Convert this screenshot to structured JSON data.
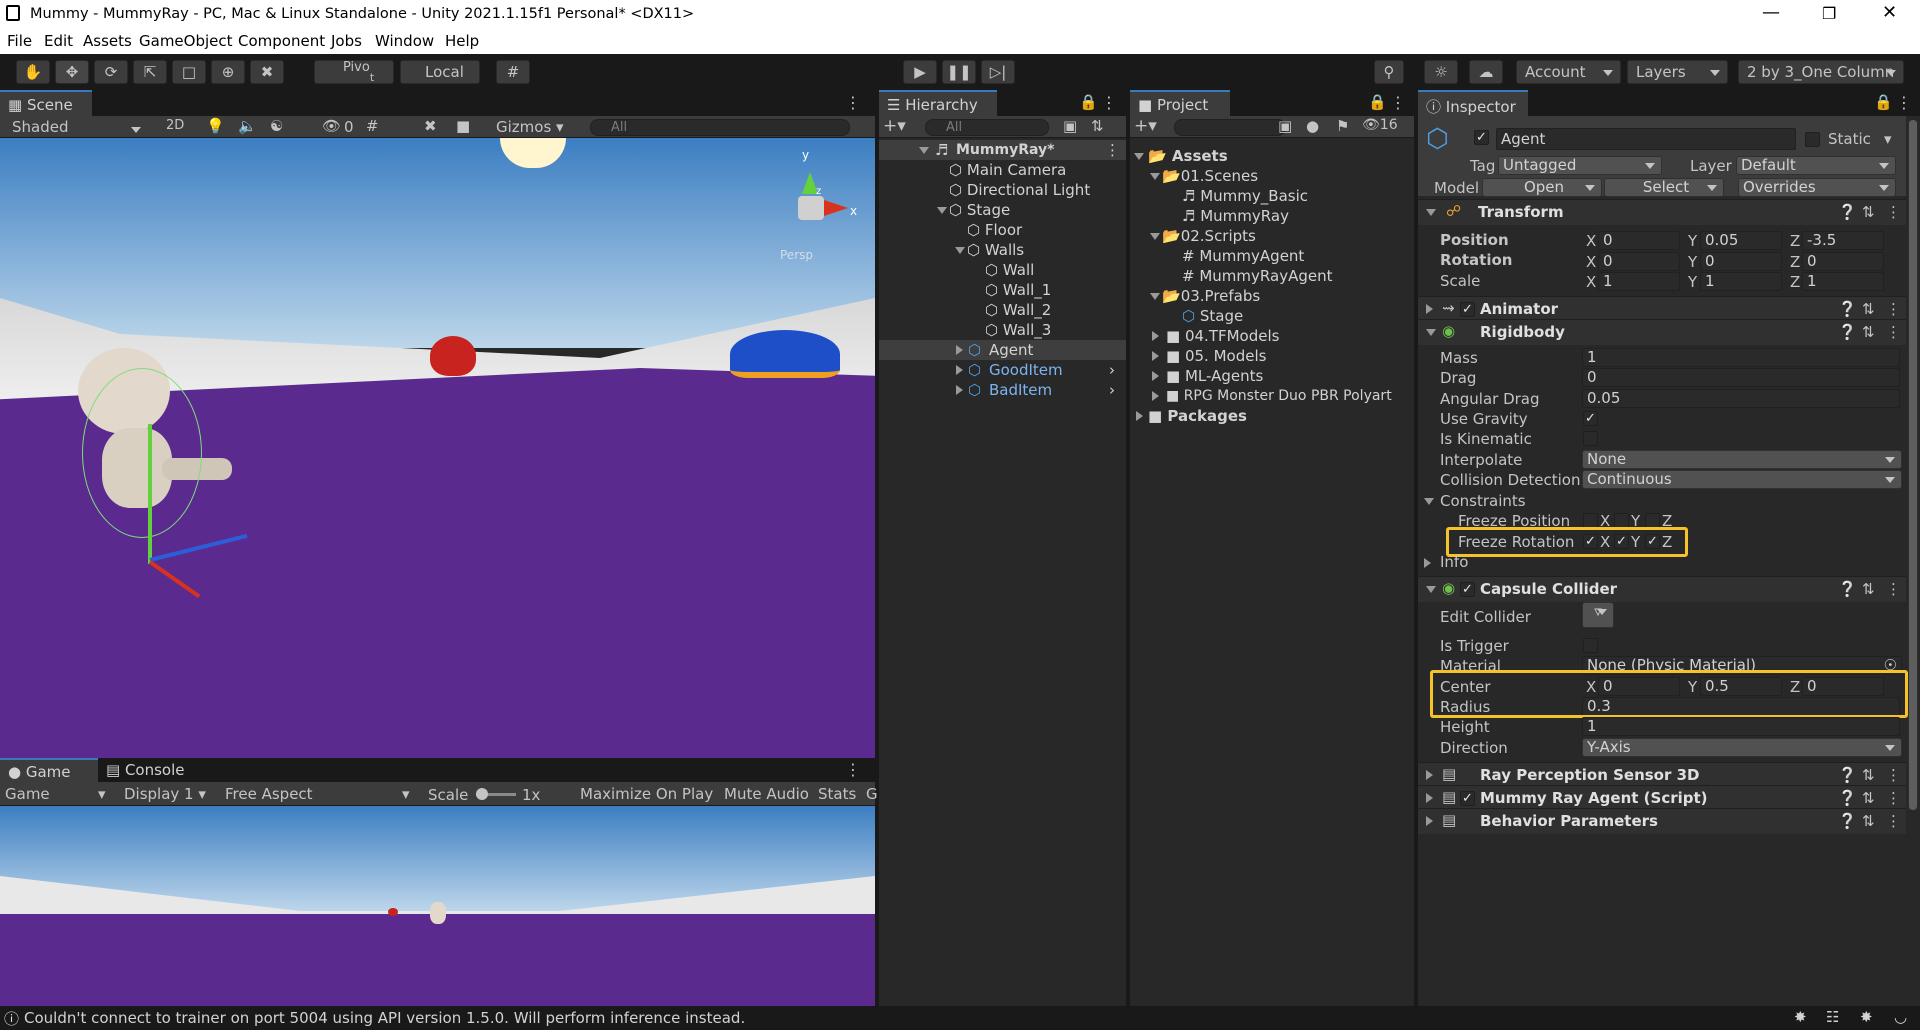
{
  "window": {
    "title": "Mummy - MummyRay - PC, Mac & Linux Standalone - Unity 2021.1.15f1 Personal* <DX11>"
  },
  "menu": [
    "File",
    "Edit",
    "Assets",
    "GameObject",
    "Component",
    "Jobs",
    "Window",
    "Help"
  ],
  "toolbar": {
    "pivot": "Pivo",
    "pivot_sub": "t",
    "local": "Local",
    "account": "Account",
    "layers": "Layers",
    "layout": "2 by 3_One Column"
  },
  "scene": {
    "tab": "Scene",
    "shading": "Shaded",
    "mode2d": "2D",
    "hidden_count": "0",
    "gizmos": "Gizmos",
    "search_placeholder": "All",
    "persp": "Persp",
    "axis_y": "y",
    "axis_x": "x",
    "axis_z": "z"
  },
  "game": {
    "tabs": [
      "Game",
      "Console"
    ],
    "display_mode": "Game",
    "display": "Display 1",
    "aspect": "Free Aspect",
    "scale_label": "Scale",
    "scale_value": "1x",
    "maximize": "Maximize On Play",
    "mute": "Mute Audio",
    "stats": "Stats",
    "gizmos_cut": "G"
  },
  "hierarchy": {
    "tab": "Hierarchy",
    "search_placeholder": "All",
    "items": [
      {
        "label": "MummyRay*",
        "bold": true
      },
      {
        "label": "Main Camera"
      },
      {
        "label": "Directional Light"
      },
      {
        "label": "Stage"
      },
      {
        "label": "Floor"
      },
      {
        "label": "Walls"
      },
      {
        "label": "Wall"
      },
      {
        "label": "Wall_1"
      },
      {
        "label": "Wall_2"
      },
      {
        "label": "Wall_3"
      },
      {
        "label": "Agent"
      },
      {
        "label": "GoodItem"
      },
      {
        "label": "BadItem"
      }
    ]
  },
  "project": {
    "tab": "Project",
    "hidden_count": "16",
    "items": [
      {
        "label": "Assets"
      },
      {
        "label": "01.Scenes"
      },
      {
        "label": "Mummy_Basic"
      },
      {
        "label": "MummyRay"
      },
      {
        "label": "02.Scripts"
      },
      {
        "label": "MummyAgent"
      },
      {
        "label": "MummyRayAgent"
      },
      {
        "label": "03.Prefabs"
      },
      {
        "label": "Stage"
      },
      {
        "label": "04.TFModels"
      },
      {
        "label": "05. Models"
      },
      {
        "label": "ML-Agents"
      },
      {
        "label": "RPG Monster Duo PBR Polyart"
      },
      {
        "label": "Packages"
      }
    ]
  },
  "inspector": {
    "tab": "Inspector",
    "object_name": "Agent",
    "static_label": "Static",
    "tag_label": "Tag",
    "tag": "Untagged",
    "layer_label": "Layer",
    "layer": "Default",
    "model_label": "Model",
    "open": "Open",
    "select": "Select",
    "overrides": "Overrides",
    "transform": {
      "name": "Transform",
      "position_label": "Position",
      "rotation_label": "Rotation",
      "scale_label": "Scale",
      "position": {
        "x": "0",
        "y": "0.05",
        "z": "-3.5"
      },
      "rotation": {
        "x": "0",
        "y": "0",
        "z": "0"
      },
      "scale": {
        "x": "1",
        "y": "1",
        "z": "1"
      }
    },
    "axis_labels": {
      "x": "X",
      "y": "Y",
      "z": "Z"
    },
    "animator": "Animator",
    "rigidbody": {
      "name": "Rigidbody",
      "mass_label": "Mass",
      "mass": "1",
      "drag_label": "Drag",
      "drag": "0",
      "angular_drag_label": "Angular Drag",
      "angular_drag": "0.05",
      "use_gravity_label": "Use Gravity",
      "is_kinematic_label": "Is Kinematic",
      "interpolate_label": "Interpolate",
      "interpolate": "None",
      "collision_label": "Collision Detection",
      "collision": "Continuous",
      "constraints_label": "Constraints",
      "freeze_position_label": "Freeze Position",
      "freeze_rotation_label": "Freeze Rotation",
      "info_label": "Info",
      "check": "✓"
    },
    "capsule": {
      "name": "Capsule Collider",
      "edit_label": "Edit Collider",
      "trigger_label": "Is Trigger",
      "material_label": "Material",
      "material": "None (Physic Material)",
      "center_label": "Center",
      "center": {
        "x": "0",
        "y": "0.5",
        "z": "0"
      },
      "radius_label": "Radius",
      "radius": "0.3",
      "height_label": "Height",
      "height": "1",
      "direction_label": "Direction",
      "direction": "Y-Axis"
    },
    "ray_sensor": "Ray Perception Sensor 3D",
    "agent_script": "Mummy Ray Agent (Script)",
    "behavior": "Behavior Parameters"
  },
  "status": {
    "message": "Couldn't connect to trainer on port 5004 using API version 1.5.0. Will perform inference instead."
  },
  "colors": {
    "highlight": "#f6c22a",
    "selection_blue": "#3a79bb",
    "floor_purple": "#5b2a8f",
    "prefab_blue": "#4f9fe6"
  }
}
